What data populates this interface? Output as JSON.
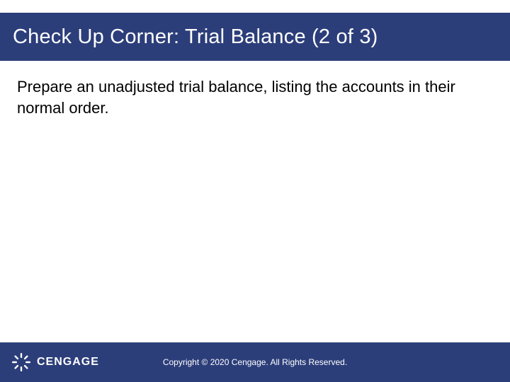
{
  "title": "Check Up Corner: Trial Balance (2 of 3)",
  "body": "Prepare an unadjusted trial balance, listing the accounts in their normal order.",
  "footer": {
    "brand": "CENGAGE",
    "copyright": "Copyright © 2020 Cengage. All Rights Reserved."
  }
}
